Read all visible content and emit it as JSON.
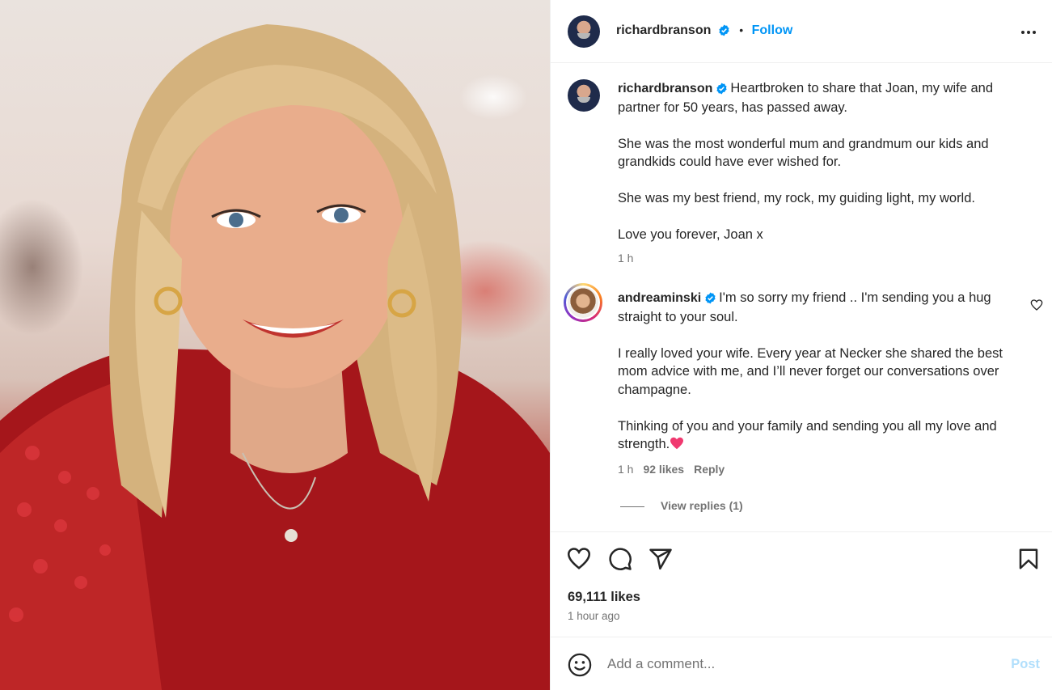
{
  "post": {
    "username": "richardbranson",
    "follow_label": "Follow",
    "separator": "•",
    "verified_color": "#0095f6"
  },
  "caption": {
    "username": "richardbranson",
    "first_line": "Heartbroken to share that Joan, my wife and partner for 50 years, has passed away.",
    "paragraphs": [
      "She was the most wonderful mum and grandmum our kids and grandkids could have ever wished for.",
      "She was my best friend, my rock, my guiding light, my world.",
      "Love you forever, Joan x"
    ],
    "time": "1 h"
  },
  "comment": {
    "username": "andreaminski",
    "first_line": "I'm so sorry my friend .. I'm sending you a hug straight to your soul.",
    "paragraphs": [
      "I really loved your wife. Every year at Necker she shared the best mom advice with me, and I’ll never forget our conversations over champagne.",
      "Thinking of you and your family and sending you all my love and strength."
    ],
    "emoji": "heart-emoji",
    "time": "1 h",
    "likes": "92 likes",
    "reply_label": "Reply",
    "view_replies": "View replies (1)"
  },
  "actions": {
    "icons": [
      "heart-icon",
      "comment-icon",
      "share-icon",
      "bookmark-icon"
    ],
    "likes": "69,111 likes",
    "time_ago": "1 hour ago"
  },
  "add_comment": {
    "emoji_icon": "smiley-icon",
    "placeholder": "Add a comment...",
    "post_label": "Post",
    "post_color": "#b2dffc"
  }
}
